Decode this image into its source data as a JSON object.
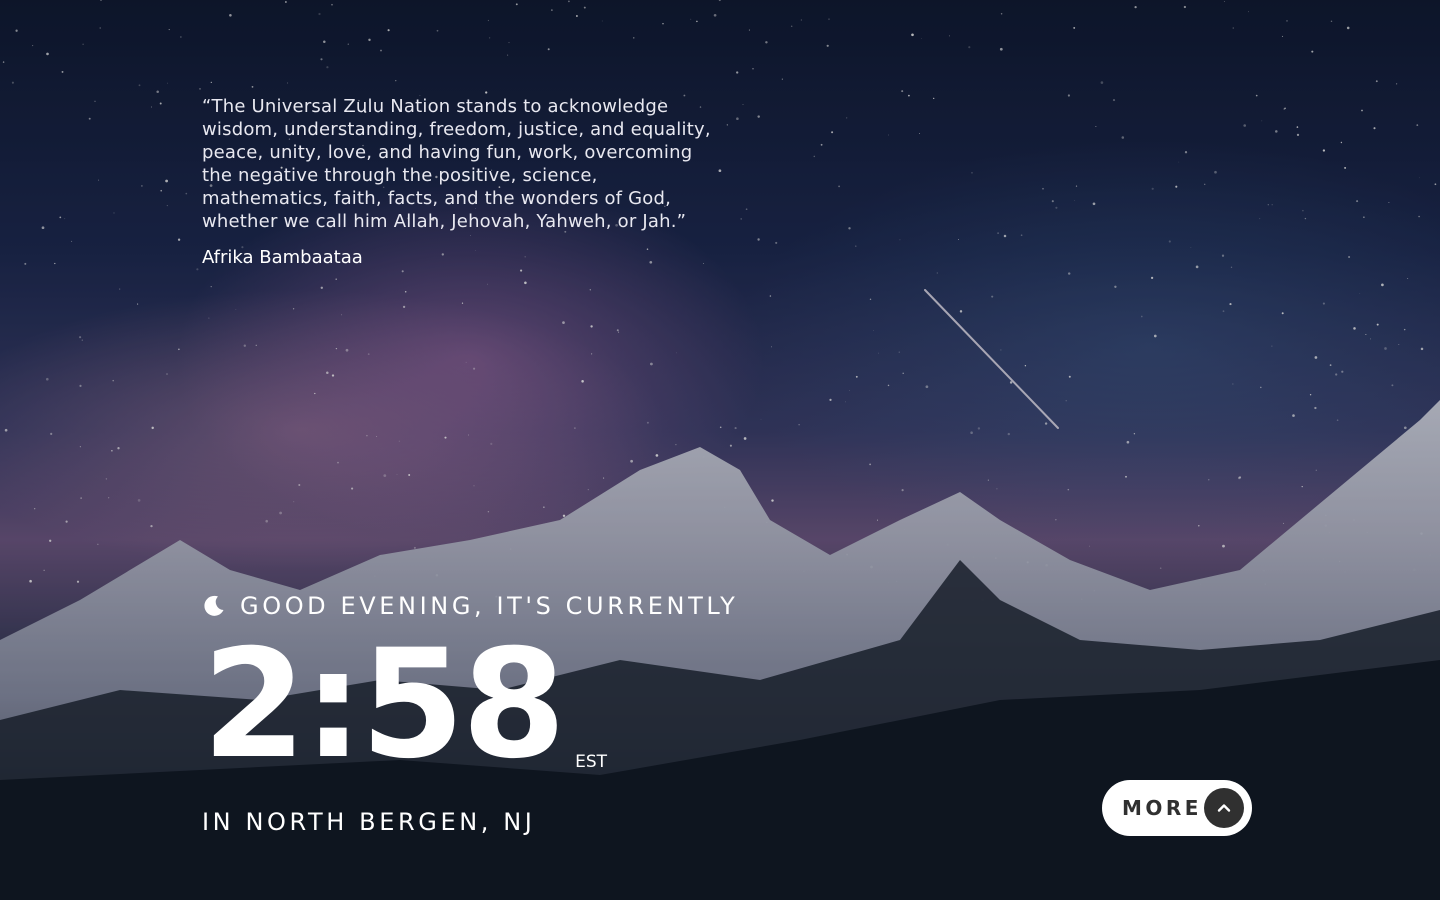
{
  "quote": {
    "text": "“The Universal Zulu Nation stands to acknowledge wisdom, understanding, freedom, justice, and equality, peace, unity, love, and having fun, work, overcoming the negative through the positive, science, mathematics, faith, facts, and the wonders of God, whether we call him Allah, Jehovah, Yahweh, or Jah.”",
    "author": "Afrika Bambaataa"
  },
  "greeting": {
    "icon": "moon-icon",
    "text": "GOOD EVENING, IT'S CURRENTLY"
  },
  "clock": {
    "time": "2:58",
    "timezone": "EST"
  },
  "location": {
    "text": "IN NORTH BERGEN, NJ"
  },
  "more_button": {
    "label": "MORE",
    "icon": "chevron-up-icon"
  },
  "colors": {
    "text": "#ffffff",
    "button_bg": "#ffffff",
    "button_icon_bg": "#303030"
  }
}
